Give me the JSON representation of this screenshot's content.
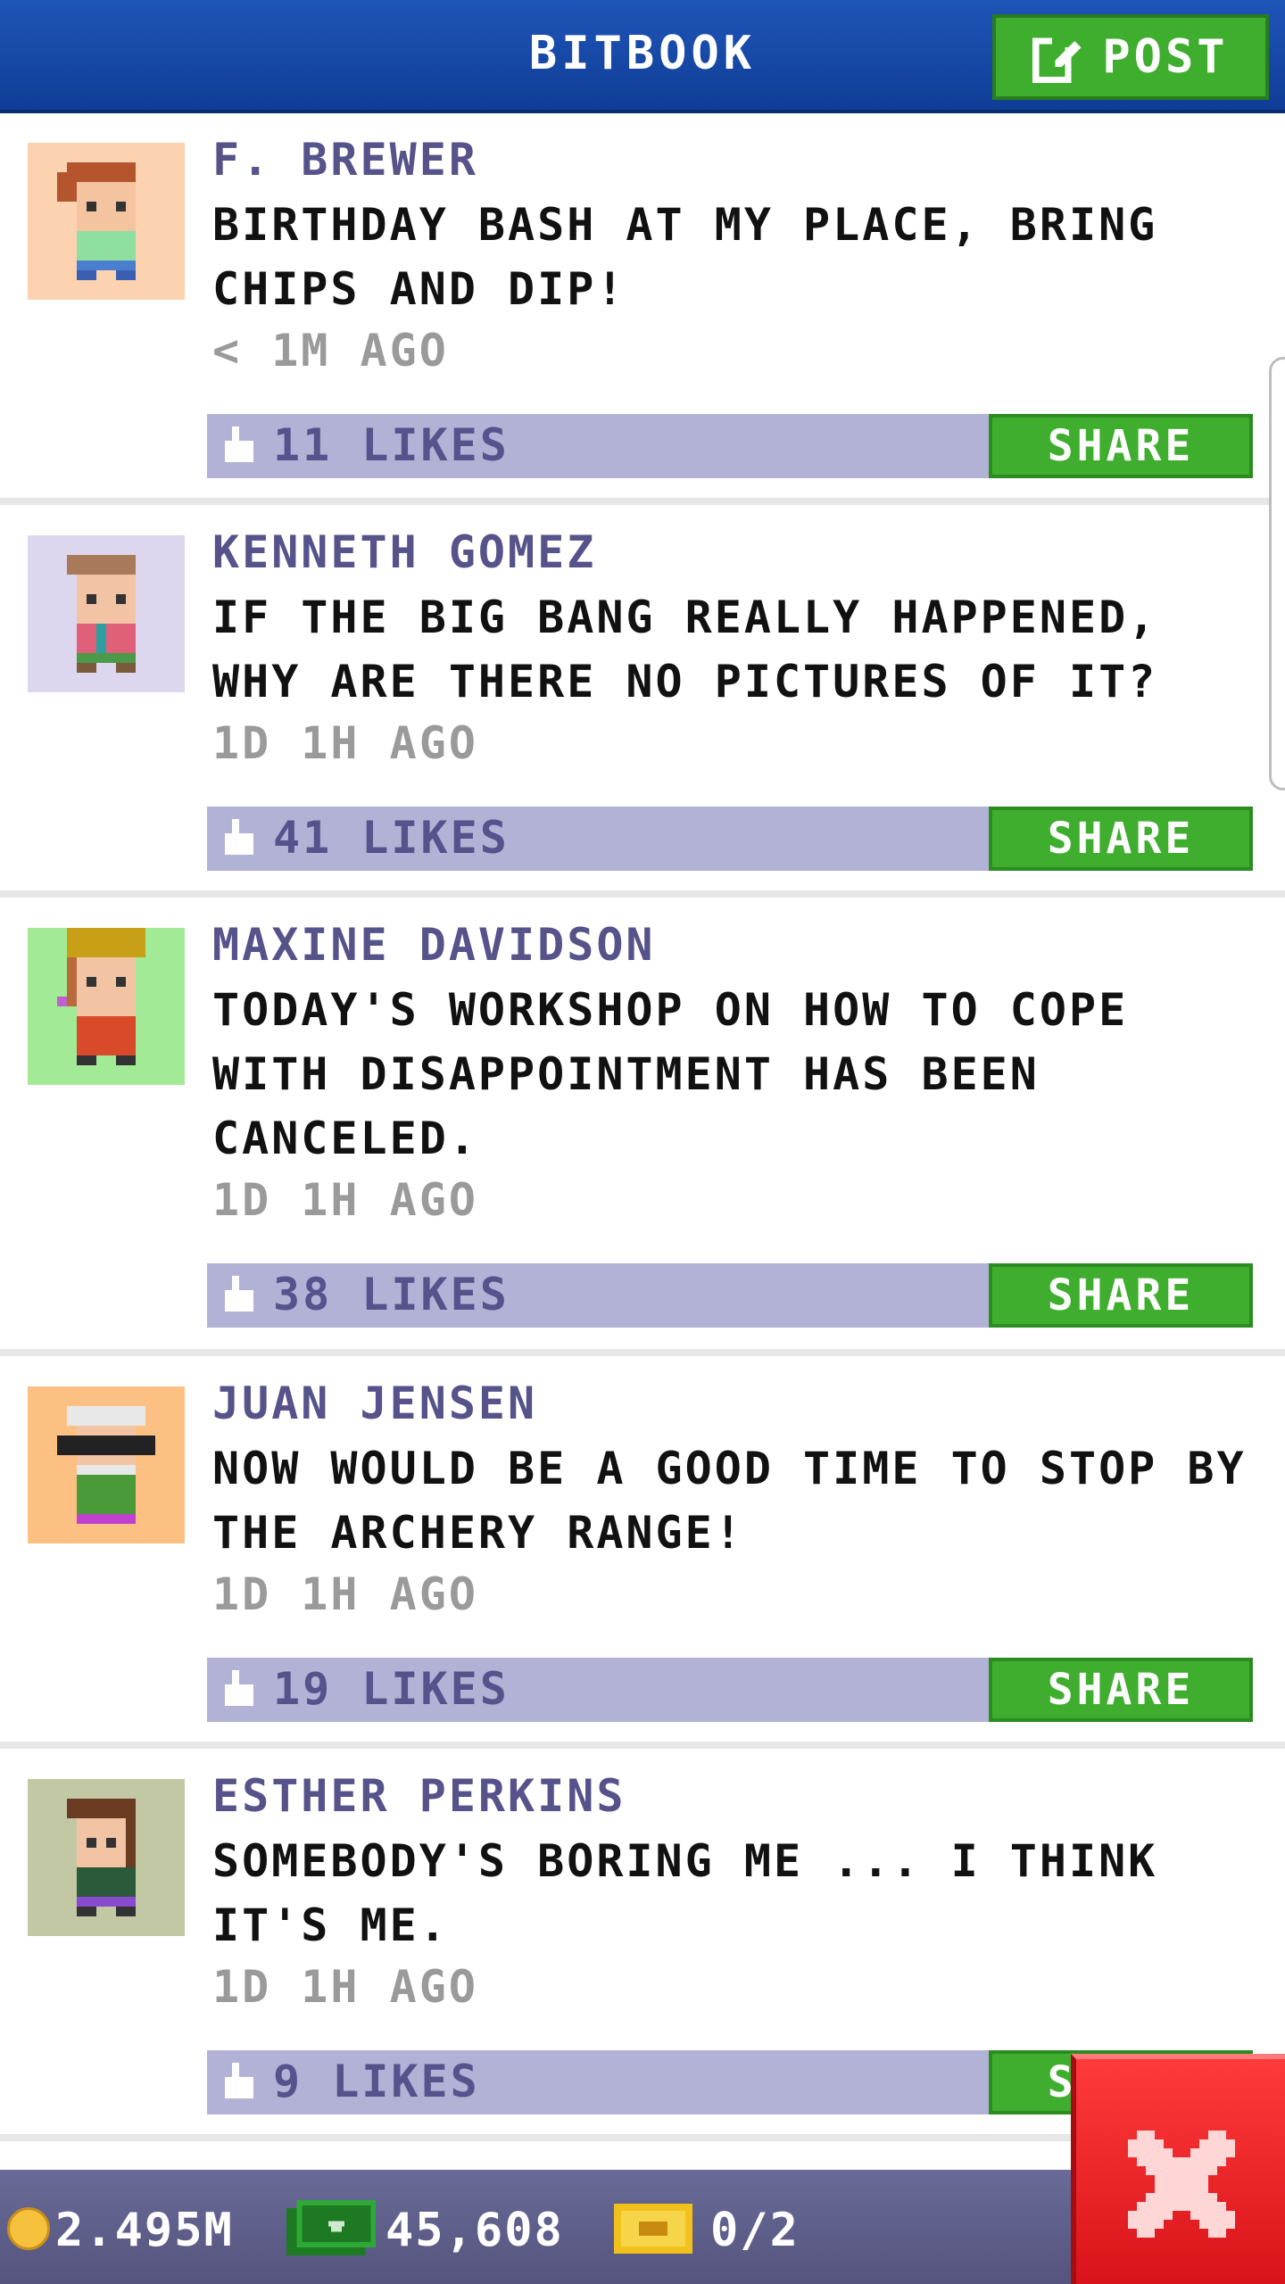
{
  "header": {
    "title": "BITBOOK",
    "post_label": "POST",
    "colors": {
      "bar": "#1a4fb0",
      "post_button": "#3fae2e"
    }
  },
  "feed": {
    "share_label": "SHARE",
    "posts": [
      {
        "author": "F. BREWER",
        "text": "BIRTHDAY BASH AT MY PLACE, BRING CHIPS AND DIP!",
        "time": "< 1M AGO",
        "likes": "11 LIKES",
        "avatar_bg": "#fdd2b1"
      },
      {
        "author": "KENNETH GOMEZ",
        "text": "IF THE BIG BANG REALLY HAPPENED, WHY ARE THERE NO PICTURES OF IT?",
        "time": "1D 1H AGO",
        "likes": "41 LIKES",
        "avatar_bg": "#ddd6ef"
      },
      {
        "author": "MAXINE DAVIDSON",
        "text": "TODAY'S WORKSHOP ON HOW TO COPE WITH DISAPPOINTMENT HAS BEEN CANCELED.",
        "time": "1D 1H AGO",
        "likes": "38 LIKES",
        "avatar_bg": "#a3ea96"
      },
      {
        "author": "JUAN JENSEN",
        "text": "NOW WOULD BE A GOOD TIME TO STOP BY THE ARCHERY RANGE!",
        "time": "1D 1H AGO",
        "likes": "19 LIKES",
        "avatar_bg": "#fdc083"
      },
      {
        "author": "ESTHER PERKINS",
        "text": "SOMEBODY'S BORING ME ... I THINK IT'S ME.",
        "time": "1D 1H AGO",
        "likes": "9 LIKES",
        "avatar_bg": "#c3c8a4"
      }
    ]
  },
  "status_bar": {
    "coins": "2.495M",
    "bux": "45,608",
    "tickets": "0/2",
    "icons": [
      "coin-icon",
      "bux-icon",
      "ticket-icon"
    ]
  },
  "close_button": {
    "icon": "close-icon",
    "color": "#e52228"
  }
}
